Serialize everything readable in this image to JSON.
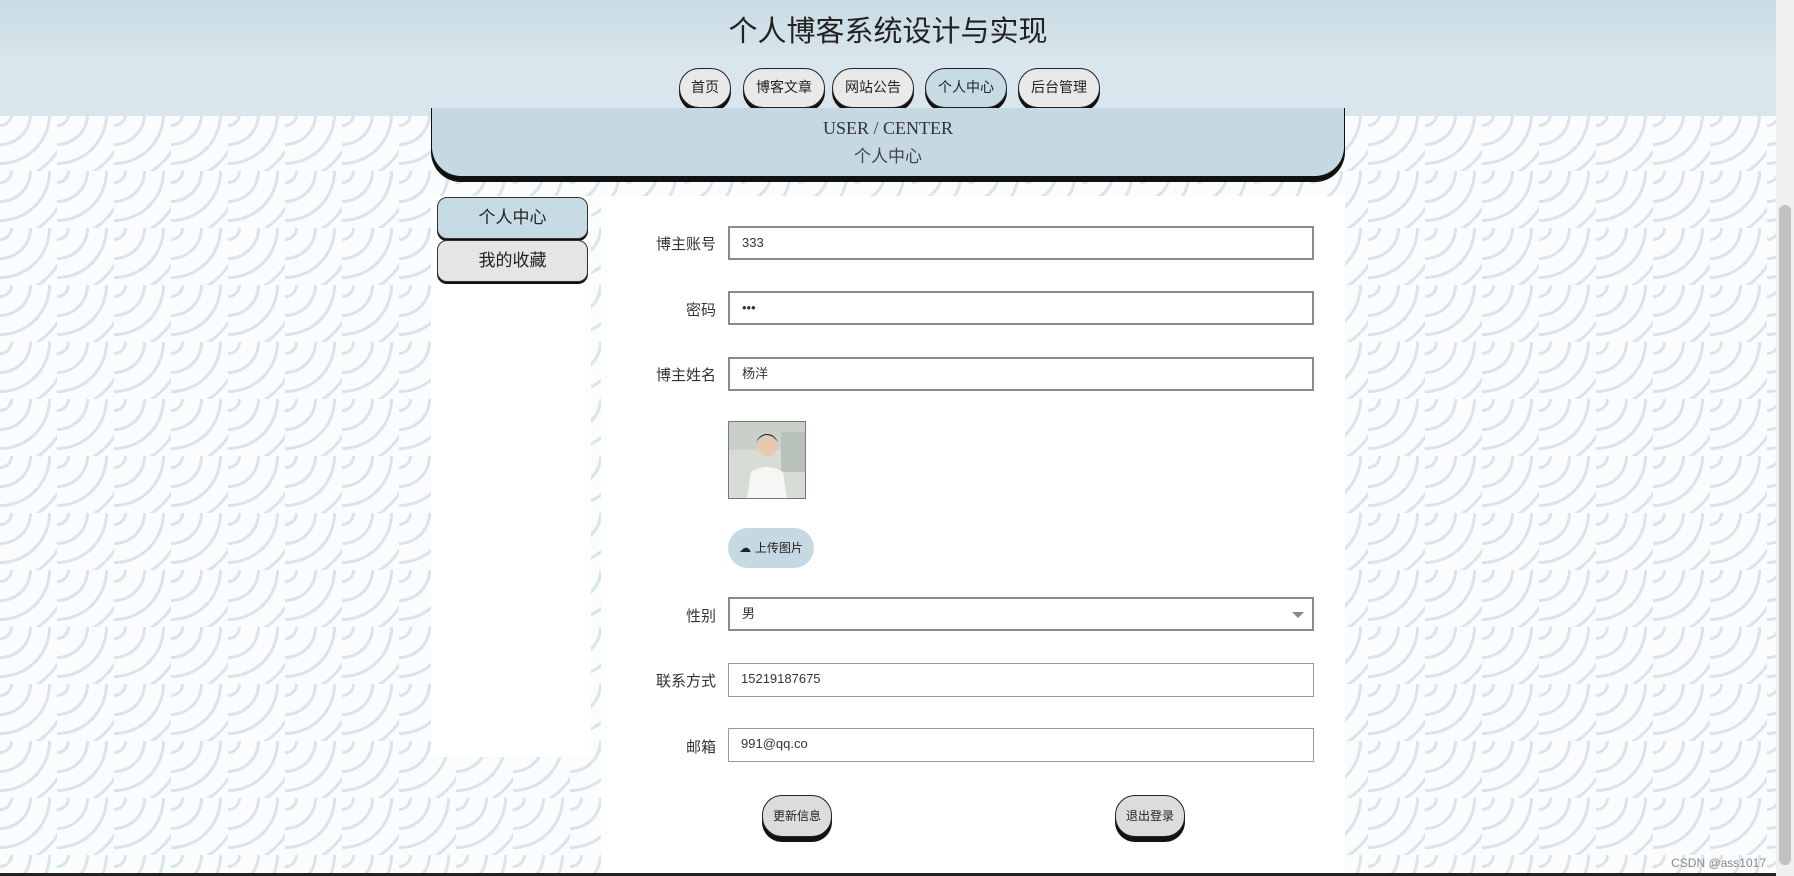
{
  "header": {
    "title": "个人博客系统设计与实现"
  },
  "nav": {
    "items": [
      {
        "label": "首页"
      },
      {
        "label": "博客文章"
      },
      {
        "label": "网站公告"
      },
      {
        "label": "个人中心"
      },
      {
        "label": "后台管理"
      }
    ],
    "active": "个人中心"
  },
  "banner": {
    "en": "USER / CENTER",
    "cn": "个人中心"
  },
  "sidebar": {
    "items": [
      {
        "label": "个人中心"
      },
      {
        "label": "我的收藏"
      }
    ]
  },
  "form": {
    "account": {
      "label": "博主账号",
      "value": "333"
    },
    "password": {
      "label": "密码",
      "value": "•••"
    },
    "name": {
      "label": "博主姓名",
      "value": "杨洋"
    },
    "upload_label": "上传图片",
    "gender": {
      "label": "性别",
      "value": "男"
    },
    "contact": {
      "label": "联系方式",
      "value": "15219187675"
    },
    "email": {
      "label": "邮箱",
      "value": "991@qq.co"
    },
    "update_label": "更新信息",
    "logout_label": "退出登录"
  },
  "watermark": "CSDN @ass1017",
  "colors": {
    "accent": "#c6d9e2",
    "button_grey": "#e5e5e5"
  }
}
